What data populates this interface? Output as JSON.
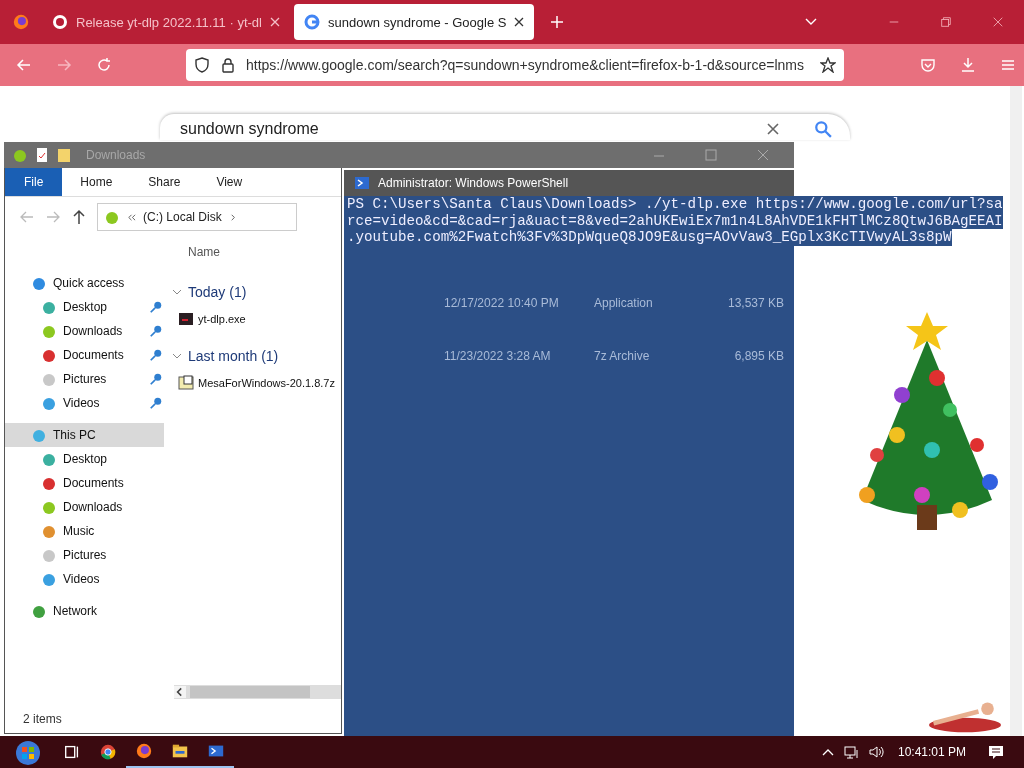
{
  "browser": {
    "tabs": [
      {
        "title": "Release yt-dlp 2022.11.11 · yt-dl",
        "selected": false,
        "kind": "github"
      },
      {
        "title": "sundown syndrome - Google S",
        "selected": true,
        "kind": "google"
      }
    ],
    "url": "https://www.google.com/search?q=sundown+syndrome&client=firefox-b-1-d&source=lnms",
    "search": "sundown syndrome"
  },
  "explorer": {
    "title": "Downloads",
    "ribbon": [
      {
        "label": "File",
        "selected": true
      },
      {
        "label": "Home",
        "selected": false
      },
      {
        "label": "Share",
        "selected": false
      },
      {
        "label": "View",
        "selected": false
      }
    ],
    "path": "(C:) Local Disk",
    "nav": [
      {
        "label": "Quick access",
        "selected": false,
        "color": "#2f8be0",
        "children": [
          {
            "label": "Desktop",
            "pinned": true,
            "color": "#3bb0a0"
          },
          {
            "label": "Downloads",
            "pinned": true,
            "color": "#8cc820"
          },
          {
            "label": "Documents",
            "pinned": true,
            "color": "#d83030"
          },
          {
            "label": "Pictures",
            "pinned": true,
            "color": "#c8c8c8"
          },
          {
            "label": "Videos",
            "pinned": true,
            "color": "#3aa0e0"
          }
        ]
      },
      {
        "label": "This PC",
        "selected": true,
        "color": "#40b0e0",
        "children": [
          {
            "label": "Desktop",
            "pinned": false,
            "color": "#3bb0a0"
          },
          {
            "label": "Documents",
            "pinned": false,
            "color": "#d83030"
          },
          {
            "label": "Downloads",
            "pinned": false,
            "color": "#8cc820"
          },
          {
            "label": "Music",
            "pinned": false,
            "color": "#e09030"
          },
          {
            "label": "Pictures",
            "pinned": false,
            "color": "#c8c8c8"
          },
          {
            "label": "Videos",
            "pinned": false,
            "color": "#3aa0e0"
          }
        ]
      },
      {
        "label": "Network",
        "selected": false,
        "color": "#40a040"
      }
    ],
    "name_column": "Name",
    "groups": [
      {
        "label": "Today (1)",
        "expanded": true,
        "files": [
          {
            "name": "yt-dlp.exe",
            "kind": "exe",
            "date": "12/17/2022 10:40 PM",
            "type": "Application",
            "size": "13,537 KB"
          }
        ]
      },
      {
        "label": "Last month (1)",
        "expanded": true,
        "files": [
          {
            "name": "MesaForWindows-20.1.8.7z",
            "kind": "archive",
            "date": "11/23/2022 3:28 AM",
            "type": "7z Archive",
            "size": "6,895 KB"
          }
        ]
      }
    ],
    "status": "2 items"
  },
  "powershell": {
    "title": "Administrator: Windows PowerShell",
    "lines": [
      "PS C:\\Users\\Santa Claus\\Downloads> ./yt-dlp.exe https://www.google.com/url?sa",
      "rce=video&cd=&cad=rja&uact=8&ved=2ahUKEwiEx7m1n4L8AhVDE1kFHTlMCz8QtwJ6BAgEEAI",
      ".youtube.com%2Fwatch%3Fv%3DpWqueQ8JO9E&usg=AOvVaw3_EGplx3KcTIVwyAL3s8pW"
    ]
  },
  "taskbar": {
    "apps": [
      {
        "kind": "taskview",
        "active": false
      },
      {
        "kind": "chrome",
        "active": false
      },
      {
        "kind": "firefox",
        "active": true
      },
      {
        "kind": "explorer",
        "active": true
      },
      {
        "kind": "powershell",
        "active": true
      }
    ],
    "clock": "10:41:01 PM"
  }
}
